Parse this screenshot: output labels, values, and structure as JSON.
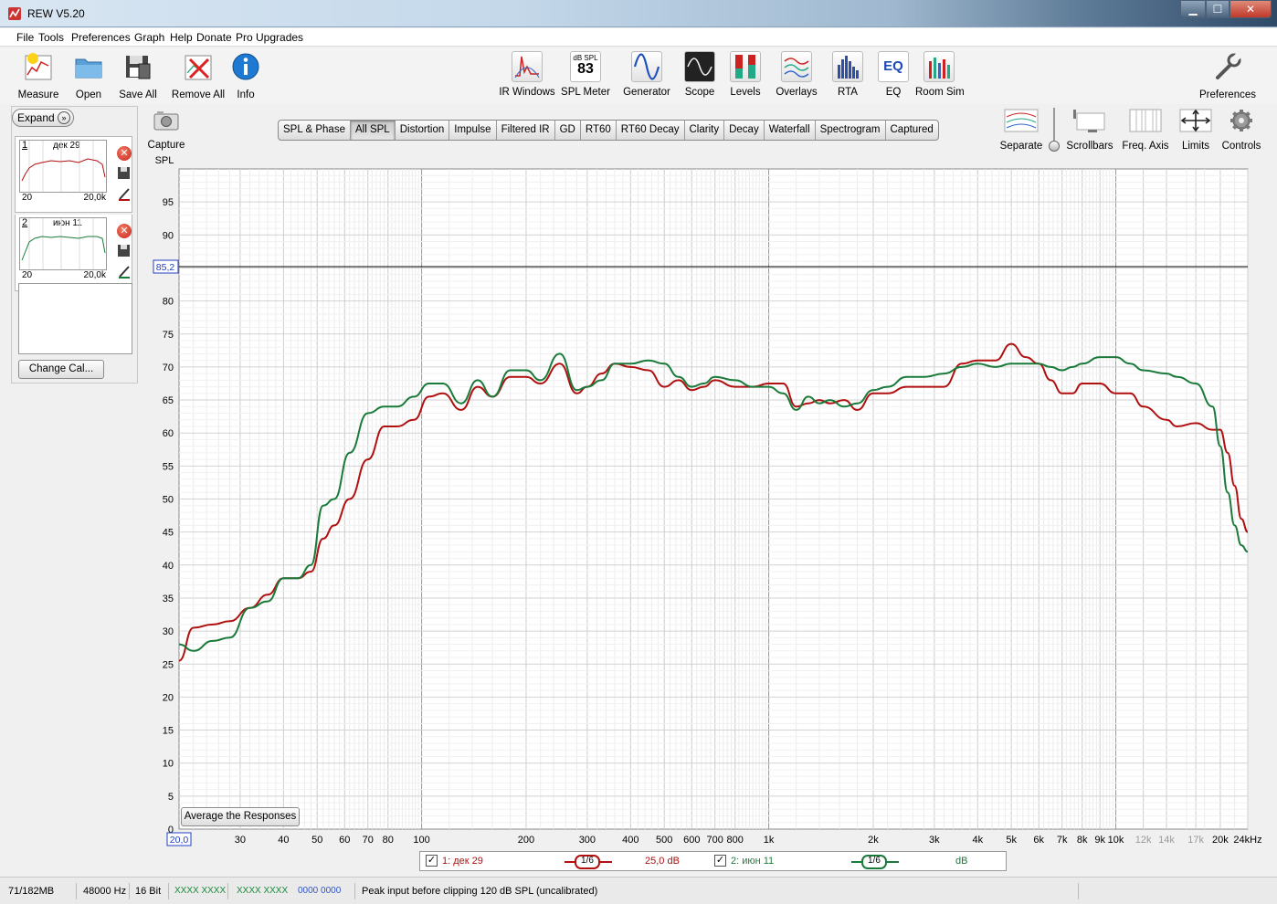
{
  "window": {
    "title": "REW V5.20"
  },
  "menu": [
    "File",
    "Tools",
    "Preferences",
    "Graph",
    "Help",
    "Donate",
    "Pro Upgrades"
  ],
  "toolbar": {
    "left": [
      {
        "label": "Measure",
        "icon": "measure-icon"
      },
      {
        "label": "Open",
        "icon": "folder-icon"
      },
      {
        "label": "Save All",
        "icon": "save-icon"
      },
      {
        "label": "Remove All",
        "icon": "remove-all-icon"
      },
      {
        "label": "Info",
        "icon": "info-icon"
      }
    ],
    "center": [
      {
        "label": "IR Windows",
        "icon": "ir-windows-icon"
      },
      {
        "label": "SPL Meter",
        "icon": "spl-meter-icon",
        "badge_top": "dB SPL",
        "badge_value": "83"
      },
      {
        "label": "Generator",
        "icon": "generator-icon"
      },
      {
        "label": "Scope",
        "icon": "scope-icon"
      },
      {
        "label": "Levels",
        "icon": "levels-icon"
      },
      {
        "label": "Overlays",
        "icon": "overlays-icon"
      },
      {
        "label": "RTA",
        "icon": "rta-icon"
      },
      {
        "label": "EQ",
        "icon": "eq-icon"
      },
      {
        "label": "Room Sim",
        "icon": "room-sim-icon"
      }
    ],
    "preferences": "Preferences"
  },
  "sidebar": {
    "expand": "Expand",
    "measurements": [
      {
        "index": "1",
        "name": "дек 29",
        "lo": "20",
        "hi": "20,0k"
      },
      {
        "index": "2",
        "name": "июн 11",
        "lo": "20",
        "hi": "20,0k"
      }
    ],
    "change_cal": "Change Cal..."
  },
  "capture": "Capture",
  "tabs": [
    "SPL & Phase",
    "All SPL",
    "Distortion",
    "Impulse",
    "Filtered IR",
    "GD",
    "RT60",
    "RT60 Decay",
    "Clarity",
    "Decay",
    "Waterfall",
    "Spectrogram",
    "Captured"
  ],
  "active_tab": "All SPL",
  "right_tools": [
    "Separate",
    "Scrollbars",
    "Freq. Axis",
    "Limits",
    "Controls"
  ],
  "avg_button": "Average the Responses",
  "cursor_y_readout": "85,2",
  "cursor_x_readout": "20,0",
  "legend": {
    "m1": {
      "label": "1: дек 29",
      "smoothing": "1/6",
      "offset": "25,0 dB"
    },
    "m2": {
      "label": "2: июн 11",
      "smoothing": "1/6",
      "offset": "dB"
    }
  },
  "status": {
    "memory": "71/182MB",
    "rate": "48000 Hz",
    "bits": "16 Bit",
    "ch1": "XXXX XXXX",
    "ch2": "XXXX XXXX",
    "ch3": "0000 0000",
    "message": "Peak input before clipping 120 dB SPL (uncalibrated)"
  },
  "colors": {
    "series1": "#b01010",
    "series2": "#1a7a3a"
  },
  "chart_data": {
    "type": "line",
    "ylabel": "SPL",
    "xlabel": "",
    "x_scale": "log",
    "xlim": [
      20,
      24000
    ],
    "ylim": [
      0,
      100
    ],
    "y_ticks": [
      0,
      5,
      10,
      15,
      20,
      25,
      30,
      35,
      40,
      45,
      50,
      55,
      60,
      65,
      70,
      75,
      80,
      85,
      90,
      95
    ],
    "x_ticks": [
      {
        "v": 30,
        "t": "30"
      },
      {
        "v": 40,
        "t": "40"
      },
      {
        "v": 50,
        "t": "50"
      },
      {
        "v": 60,
        "t": "60"
      },
      {
        "v": 70,
        "t": "70"
      },
      {
        "v": 80,
        "t": "80"
      },
      {
        "v": 100,
        "t": "100"
      },
      {
        "v": 200,
        "t": "200"
      },
      {
        "v": 300,
        "t": "300"
      },
      {
        "v": 400,
        "t": "400"
      },
      {
        "v": 500,
        "t": "500"
      },
      {
        "v": 600,
        "t": "600"
      },
      {
        "v": 700,
        "t": "700"
      },
      {
        "v": 800,
        "t": "800"
      },
      {
        "v": 1000,
        "t": "1k"
      },
      {
        "v": 2000,
        "t": "2k"
      },
      {
        "v": 3000,
        "t": "3k"
      },
      {
        "v": 4000,
        "t": "4k"
      },
      {
        "v": 5000,
        "t": "5k"
      },
      {
        "v": 6000,
        "t": "6k"
      },
      {
        "v": 7000,
        "t": "7k"
      },
      {
        "v": 8000,
        "t": "8k"
      },
      {
        "v": 9000,
        "t": "9k"
      },
      {
        "v": 10000,
        "t": "10k"
      },
      {
        "v": 12000,
        "t": "12k"
      },
      {
        "v": 14000,
        "t": "14k"
      },
      {
        "v": 17000,
        "t": "17k"
      },
      {
        "v": 20000,
        "t": "20k"
      },
      {
        "v": 24000,
        "t": "24kHz"
      }
    ],
    "cursor_y": 85.2,
    "series": [
      {
        "name": "1: дек 29",
        "x": [
          20,
          22,
          25,
          28,
          32,
          36,
          40,
          44,
          48,
          52,
          56,
          62,
          70,
          78,
          85,
          95,
          105,
          115,
          130,
          145,
          160,
          180,
          200,
          220,
          250,
          280,
          300,
          330,
          360,
          400,
          450,
          500,
          550,
          600,
          650,
          700,
          800,
          900,
          1000,
          1100,
          1200,
          1300,
          1400,
          1500,
          1650,
          1800,
          2000,
          2200,
          2500,
          2800,
          3200,
          3600,
          4000,
          4500,
          5000,
          5500,
          6000,
          6500,
          7000,
          7500,
          8000,
          9000,
          10000,
          11000,
          12000,
          14000,
          15000,
          17000,
          19000,
          20000,
          21000,
          22000,
          23000,
          24000
        ],
        "y": [
          25.5,
          30.5,
          31,
          31.5,
          33.5,
          35.5,
          38,
          38,
          39,
          44,
          46,
          50,
          56,
          61,
          61,
          62,
          65.5,
          66,
          63.5,
          67,
          65.5,
          68.5,
          68.5,
          67.5,
          70.5,
          66,
          67,
          69,
          70.5,
          70,
          69.5,
          67,
          68,
          66.5,
          67,
          68,
          67,
          67,
          67.5,
          67.5,
          64,
          64.5,
          65,
          64.5,
          65,
          63.5,
          66,
          66,
          67,
          67,
          67,
          70.5,
          71,
          71,
          73.5,
          71.5,
          70.5,
          68,
          66,
          66,
          67.5,
          67.5,
          66,
          66,
          64,
          62,
          61,
          61.5,
          60.5,
          60.5,
          57,
          52,
          47,
          45
        ]
      },
      {
        "name": "2: июн 11",
        "x": [
          20,
          22,
          25,
          28,
          32,
          36,
          40,
          44,
          48,
          52,
          56,
          62,
          70,
          78,
          85,
          95,
          105,
          115,
          130,
          145,
          160,
          180,
          200,
          220,
          250,
          280,
          300,
          330,
          360,
          400,
          450,
          500,
          550,
          600,
          650,
          700,
          800,
          900,
          1000,
          1100,
          1200,
          1300,
          1400,
          1500,
          1650,
          1800,
          2000,
          2200,
          2500,
          2800,
          3200,
          3600,
          4000,
          4500,
          5000,
          5500,
          6000,
          6500,
          7000,
          7500,
          8000,
          9000,
          10000,
          11000,
          12000,
          14000,
          15000,
          17000,
          19000,
          20000,
          21000,
          22000,
          23000,
          24000
        ],
        "y": [
          28,
          27,
          28.5,
          29,
          33.5,
          34.5,
          38,
          38,
          40,
          49,
          50,
          57,
          63,
          64,
          64,
          65.5,
          67.5,
          67.5,
          64.5,
          68,
          65.5,
          69.5,
          69.5,
          68,
          72,
          66.5,
          67,
          68,
          70.5,
          70.5,
          71,
          70.5,
          68.5,
          67,
          67.5,
          68.5,
          68,
          67,
          67,
          66,
          63.5,
          65.5,
          64.5,
          65,
          64,
          64.5,
          66.5,
          67,
          68.5,
          68.5,
          69,
          70,
          70.5,
          70,
          70.5,
          70.5,
          70.5,
          70,
          69.5,
          70,
          70.5,
          71.5,
          71.5,
          70.5,
          69.5,
          69,
          68.5,
          67.5,
          64,
          58,
          51,
          46,
          43,
          42
        ]
      }
    ]
  }
}
